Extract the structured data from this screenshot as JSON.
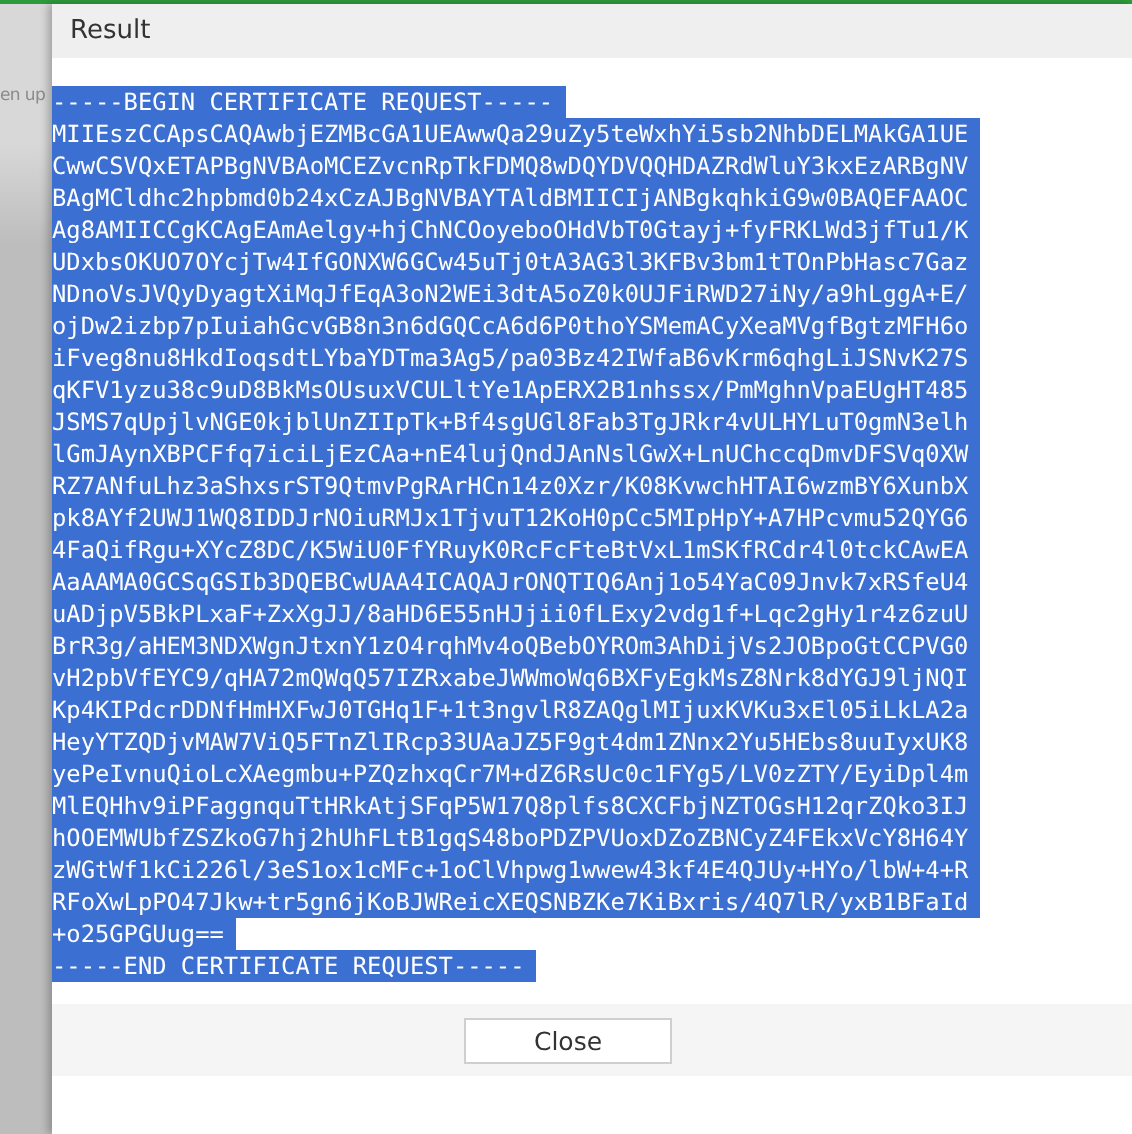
{
  "background_text": "en up",
  "dialog": {
    "title": "Result",
    "certificate": {
      "selected": true,
      "lines": [
        "-----BEGIN CERTIFICATE REQUEST-----",
        "MIIEszCCApsCAQAwbjEZMBcGA1UEAwwQa29uZy5teWxhYi5sb2NhbDELMAkGA1UE",
        "CwwCSVQxETAPBgNVBAoMCEZvcnRpTkFDMQ8wDQYDVQQHDAZRdWluY3kxEzARBgNV",
        "BAgMCldhc2hpbmd0b24xCzAJBgNVBAYTAldBMIICIjANBgkqhkiG9w0BAQEFAAOC",
        "Ag8AMIICCgKCAgEAmAelgy+hjChNCOoyeboOHdVbT0Gtayj+fyFRKLWd3jfTu1/K",
        "UDxbsOKUO7OYcjTw4IfGONXW6GCw45uTj0tA3AG3l3KFBv3bm1tTOnPbHasc7Gaz",
        "NDnoVsJVQyDyagtXiMqJfEqA3oN2WEi3dtA5oZ0k0UJFiRWD27iNy/a9hLggA+E/",
        "ojDw2izbp7pIuiahGcvGB8n3n6dGQCcA6d6P0thoYSMemACyXeaMVgfBgtzMFH6o",
        "iFveg8nu8HkdIoqsdtLYbaYDTma3Ag5/pa03Bz42IWfaB6vKrm6qhgLiJSNvK27S",
        "qKFV1yzu38c9uD8BkMsOUsuxVCULltYe1ApERX2B1nhssx/PmMghnVpaEUgHT485",
        "JSMS7qUpjlvNGE0kjblUnZIIpTk+Bf4sgUGl8Fab3TgJRkr4vULHYLuT0gmN3elh",
        "lGmJAynXBPCFfq7iciLjEzCAa+nE4lujQndJAnNslGwX+LnUChccqDmvDFSVq0XW",
        "RZ7ANfuLhz3aShxsrST9QtmvPgRArHCn14z0Xzr/K08KvwchHTAI6wzmBY6XunbX",
        "pk8AYf2UWJ1WQ8IDDJrNOiuRMJx1TjvuT12KoH0pCc5MIpHpY+A7HPcvmu52QYG6",
        "4FaQifRgu+XYcZ8DC/K5WiU0FfYRuyK0RcFcFteBtVxL1mSKfRCdr4l0tckCAwEA",
        "AaAAMA0GCSqGSIb3DQEBCwUAA4ICAQAJrONQTIQ6Anj1o54YaC09Jnvk7xRSfeU4",
        "uADjpV5BkPLxaF+ZxXgJJ/8aHD6E55nHJjii0fLExy2vdg1f+Lqc2gHy1r4z6zuU",
        "BrR3g/aHEM3NDXWgnJtxnY1zO4rqhMv4oQBebOYROm3AhDijVs2JOBpoGtCCPVG0",
        "vH2pbVfEYC9/qHA72mQWqQ57IZRxabeJWWmoWq6BXFyEgkMsZ8Nrk8dYGJ9ljNQI",
        "Kp4KIPdcrDDNfHmHXFwJ0TGHq1F+1t3ngvlR8ZAQglMIjuxKVKu3xEl05iLkLA2a",
        "HeyYTZQDjvMAW7ViQ5FTnZlIRcp33UAaJZ5F9gt4dm1ZNnx2Yu5HEbs8uuIyxUK8",
        "yePeIvnuQioLcXAegmbu+PZQzhxqCr7M+dZ6RsUc0c1FYg5/LV0zZTY/EyiDpl4m",
        "MlEQHhv9iPFaggnquTtHRkAtjSFqP5W17Q8plfs8CXCFbjNZTOGsH12qrZQko3IJ",
        "hOOEMWUbfZSZkoG7hj2hUhFLtB1gqS48boPDZPVUoxDZoZBNCyZ4FEkxVcY8H64Y",
        "zWGtWf1kCi226l/3eS1ox1cMFc+1oClVhpwg1wwew43kf4E4QJUy+HYo/lbW+4+R",
        "RFoXwLpPO47Jkw+tr5gn6jKoBJWReicXEQSNBZKe7KiBxris/4Q7lR/yxB1BFaId",
        "+o25GPGUug==",
        "-----END CERTIFICATE REQUEST-----"
      ]
    },
    "buttons": [
      {
        "label": "Close"
      }
    ]
  }
}
